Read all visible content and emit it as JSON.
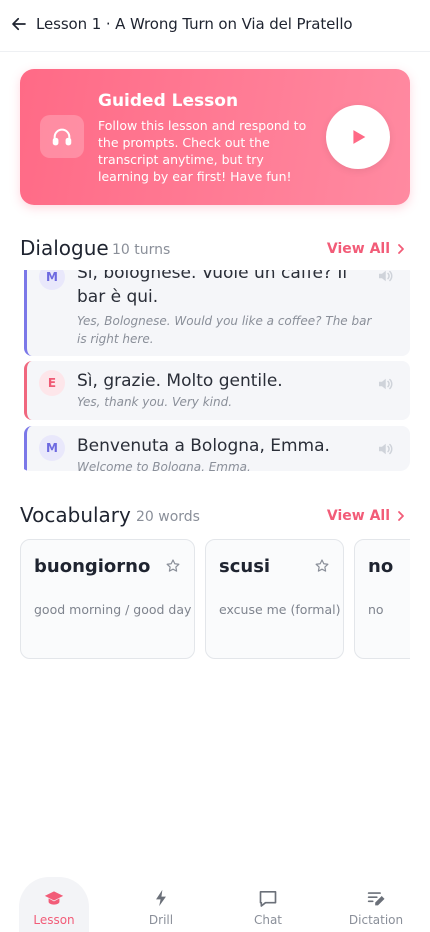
{
  "header": {
    "title": "Lesson 1 · A Wrong Turn on Via del Pratello",
    "back_icon": "arrow-left-icon"
  },
  "hero": {
    "title": "Guided Lesson",
    "description": "Follow this lesson and respond to the prompts. Check out the transcript anytime, but try learning by ear first! Have fun!",
    "icon": "headphones-icon",
    "play_icon": "play-icon",
    "gradient_start": "#ff6a86",
    "gradient_end": "#ff8aa1"
  },
  "dialogue": {
    "title": "Dialogue",
    "count": "10 turns",
    "view_all": "View All",
    "turns": [
      {
        "speaker": "M",
        "text": "Sì, bolognese. Vuole un caffè? Il bar è qui.",
        "translation": "Yes, Bolognese. Would you like a coffee? The bar is right here."
      },
      {
        "speaker": "E",
        "text": "Sì, grazie. Molto gentile.",
        "translation": "Yes, thank you. Very kind."
      },
      {
        "speaker": "M",
        "text": "Benvenuta a Bologna, Emma.",
        "translation": "Welcome to Bologna, Emma."
      }
    ]
  },
  "vocabulary": {
    "title": "Vocabulary",
    "count": "20 words",
    "view_all": "View All",
    "words": [
      {
        "word": "buongiorno",
        "meaning": "good morning / good day"
      },
      {
        "word": "scusi",
        "meaning": "excuse me (formal)"
      },
      {
        "word": "no",
        "meaning": "no"
      }
    ]
  },
  "nav": {
    "items": [
      {
        "label": "Lesson",
        "icon": "graduation-cap-icon",
        "active": true
      },
      {
        "label": "Drill",
        "icon": "lightning-icon",
        "active": false
      },
      {
        "label": "Chat",
        "icon": "chat-bubble-icon",
        "active": false
      },
      {
        "label": "Dictation",
        "icon": "dictation-icon",
        "active": false
      }
    ]
  },
  "colors": {
    "accent": "#f25c78",
    "speaker_m": "#7b78e8",
    "speaker_e": "#f0677e"
  }
}
